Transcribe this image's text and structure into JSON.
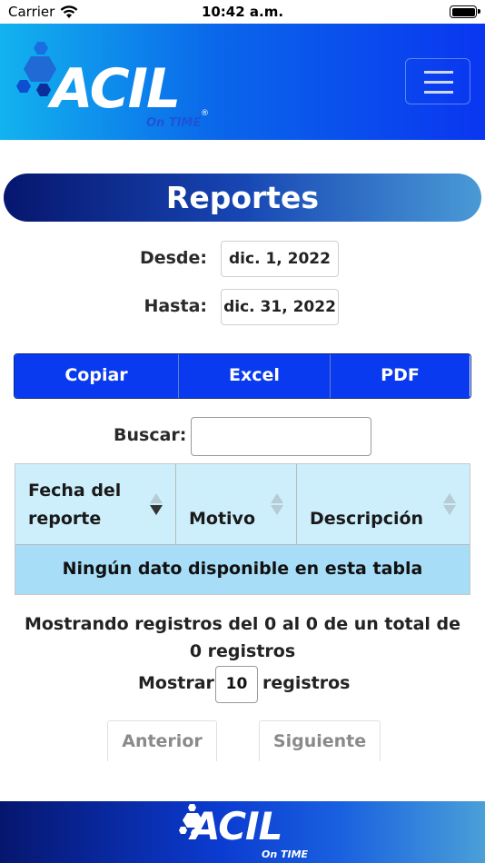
{
  "status_bar": {
    "carrier": "Carrier",
    "time": "10:42 a.m."
  },
  "header": {
    "logo_text": "ACIL",
    "logo_subtext": "On TIME",
    "menu_icon": "hamburger-icon"
  },
  "title": "Reportes",
  "filters": {
    "from_label": "Desde:",
    "from_value": "dic. 1, 2022",
    "to_label": "Hasta:",
    "to_value": "dic. 31, 2022"
  },
  "export_buttons": [
    "Copiar",
    "Excel",
    "PDF"
  ],
  "search": {
    "label": "Buscar:",
    "value": ""
  },
  "table": {
    "columns": [
      {
        "line1": "Fecha del",
        "line2": "reporte",
        "sort": "descending"
      },
      {
        "line1": "",
        "line2": "Motivo",
        "sort": "none"
      },
      {
        "line1": "",
        "line2": "Descripción",
        "sort": "none"
      }
    ],
    "empty_message": "Ningún dato disponible en esta tabla"
  },
  "info_text": "Mostrando registros del 0 al 0 de un total de 0 registros",
  "length": {
    "before": "Mostrar",
    "value": "10",
    "after": "registros"
  },
  "pagination": {
    "previous": "Anterior",
    "next": "Siguiente"
  },
  "footer": {
    "logo_text": "ACIL",
    "logo_subtext": "On TIME"
  },
  "colors": {
    "header_start": "#12b3ee",
    "header_end": "#0a36f0",
    "button_blue": "#0a3af0",
    "table_header": "#cdeffc",
    "empty_row": "#a7ddf6"
  }
}
